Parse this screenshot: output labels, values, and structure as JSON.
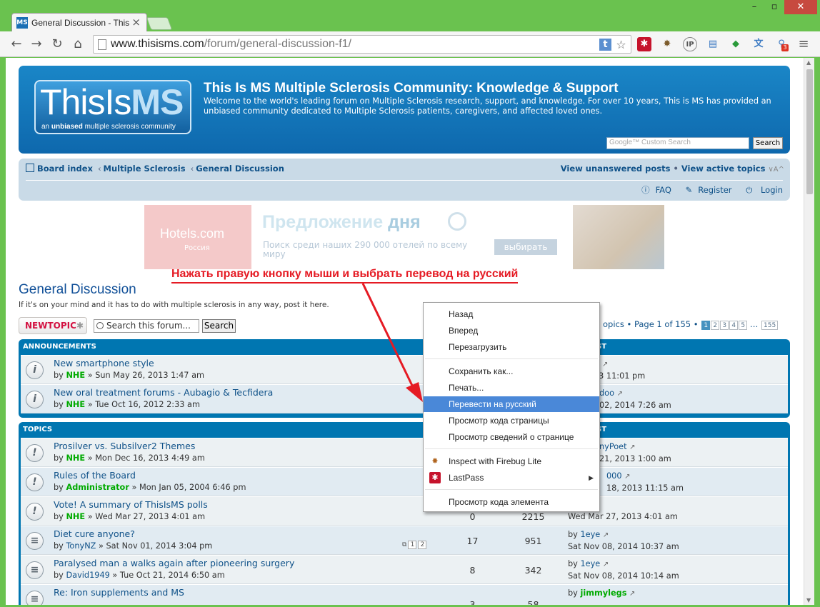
{
  "browser": {
    "tab_title": "General Discussion - This I",
    "tab_favicon": "MS",
    "url_domain": "www.thisisms.com",
    "url_path": "/forum/general-discussion-f1/",
    "win_min": "–",
    "win_max": "▫",
    "win_close": "✕",
    "icons": {
      "back": "←",
      "forward": "→",
      "reload": "↻",
      "home": "⌂",
      "translate": "t",
      "bookmark": "☆",
      "menu": "≡"
    },
    "extensions": [
      "lastpass-icon",
      "firebug-icon",
      "ip-icon",
      "window-icon",
      "cubes-icon",
      "translate-icon",
      "search-ext-icon"
    ],
    "ext_badge": "3"
  },
  "header": {
    "logo_this": "This",
    "logo_is": "Is",
    "logo_ms": "MS",
    "logo_tag_pre": "an ",
    "logo_tag_bold": "unbiased",
    "logo_tag_post": " multiple sclerosis community",
    "title": "This Is MS Multiple Sclerosis Community: Knowledge & Support",
    "description": "Welcome to the world's leading forum on Multiple Sclerosis research, support, and knowledge. For over 10 years, This is MS has provided an unbiased community dedicated to Multiple Sclerosis patients, caregivers, and affected loved ones.",
    "search_placeholder": "Google™ Custom Search",
    "search_button": "Search"
  },
  "navbar": {
    "crumbs": [
      "Board index",
      "Multiple Sclerosis",
      "General Discussion"
    ],
    "crumb_sep": "‹",
    "unanswered": "View unanswered posts",
    "active": "View active topics",
    "bullet": "•",
    "font_toggle": "∨A^",
    "faq": "FAQ",
    "register": "Register",
    "login": "Login"
  },
  "ad": {
    "brand": "Hotels.com",
    "brand_sub": "Россия",
    "headline_a": "Предложение ",
    "headline_b": "дня",
    "sub": "Поиск среди наших 290 000 отелей по всему миру",
    "button": "выбирать"
  },
  "annotation": "Нажать правую кнопку мыши и выбрать перевод на русский",
  "forum": {
    "title": "General Discussion",
    "description": "If it's on your mind and it has to do with multiple sclerosis in any way, post it here.",
    "newtopic": "NEWTOPIC",
    "newtopic_star": "✱",
    "search_value": "Search this forum...",
    "search_button": "Search",
    "pagination_text": "opics • Page 1 of 155 •",
    "pages": [
      "1",
      "2",
      "3",
      "4",
      "5"
    ],
    "ellipsis": "…",
    "last_page": "155"
  },
  "announcements": {
    "header": "ANNOUNCEMENTS",
    "last_header": "ST",
    "rows": [
      {
        "title": "New smartphone style",
        "by": "by",
        "author": "NHE",
        "date": "» Sun May 26, 2013 1:47 am",
        "last_user": "",
        "last_date": "03, 2013 11:01 pm"
      },
      {
        "title": "New oral treatment forums - Aubagio & Tecfidera",
        "by": "by",
        "author": "NHE",
        "date": "» Tue Oct 16, 2012 2:33 am",
        "last_user": "doo",
        "last_date": "02, 2014 7:26 am"
      }
    ]
  },
  "topics": {
    "header": "TOPICS",
    "last_header": "ST",
    "rows": [
      {
        "title": "Prosilver vs. Subsilver2 Themes",
        "by": "by",
        "author": "NHE",
        "date": "» Mon Dec 16, 2013 4:49 am",
        "replies": "",
        "views": "",
        "last_user": "nyPoet",
        "last_date": "21, 2013 1:00 am"
      },
      {
        "title": "Rules of the Board",
        "by": "by",
        "author": "Administrator",
        "date": "» Mon Jan 05, 2004 6:46 pm",
        "replies": "",
        "views": "",
        "last_user": "000",
        "last_date": "18, 2013 11:15 am"
      },
      {
        "title": "Vote! A summary of ThisIsMS polls",
        "by": "by",
        "author": "NHE",
        "date": "» Wed Mar 27, 2013 4:01 am",
        "replies": "0",
        "views": "2215",
        "last_user": "",
        "last_date": "Wed Mar 27, 2013 4:01 am"
      },
      {
        "title": "Diet cure anyone?",
        "by": "by",
        "author": "TonyNZ",
        "date": "» Sat Nov 01, 2014 3:04 pm",
        "replies": "17",
        "views": "951",
        "last_user": "1eye",
        "last_date": "Sat Nov 08, 2014 10:37 am",
        "mini_pages": [
          "1",
          "2"
        ]
      },
      {
        "title": "Paralysed man a walks again after pioneering surgery",
        "by": "by",
        "author": "David1949",
        "date": "» Tue Oct 21, 2014 6:50 am",
        "replies": "8",
        "views": "342",
        "last_user": "1eye",
        "last_date": "Sat Nov 08, 2014 10:14 am"
      },
      {
        "title": "Re: Iron supplements and MS",
        "by": "by",
        "author": "",
        "date": "",
        "replies": "3",
        "views": "58",
        "last_user": "jimmylegs",
        "last_date": ""
      }
    ]
  },
  "context_menu": {
    "items": [
      {
        "label": "Назад"
      },
      {
        "label": "Вперед"
      },
      {
        "label": "Перезагрузить"
      },
      {
        "label": "Сохранить как..."
      },
      {
        "label": "Печать..."
      },
      {
        "label": "Перевести на русский"
      },
      {
        "label": "Просмотр кода страницы"
      },
      {
        "label": "Просмотр  сведений о странице"
      },
      {
        "label": "Inspect with Firebug Lite"
      },
      {
        "label": "LastPass"
      },
      {
        "label": "Просмотр кода элемента"
      }
    ],
    "submenu_arrow": "▶"
  }
}
